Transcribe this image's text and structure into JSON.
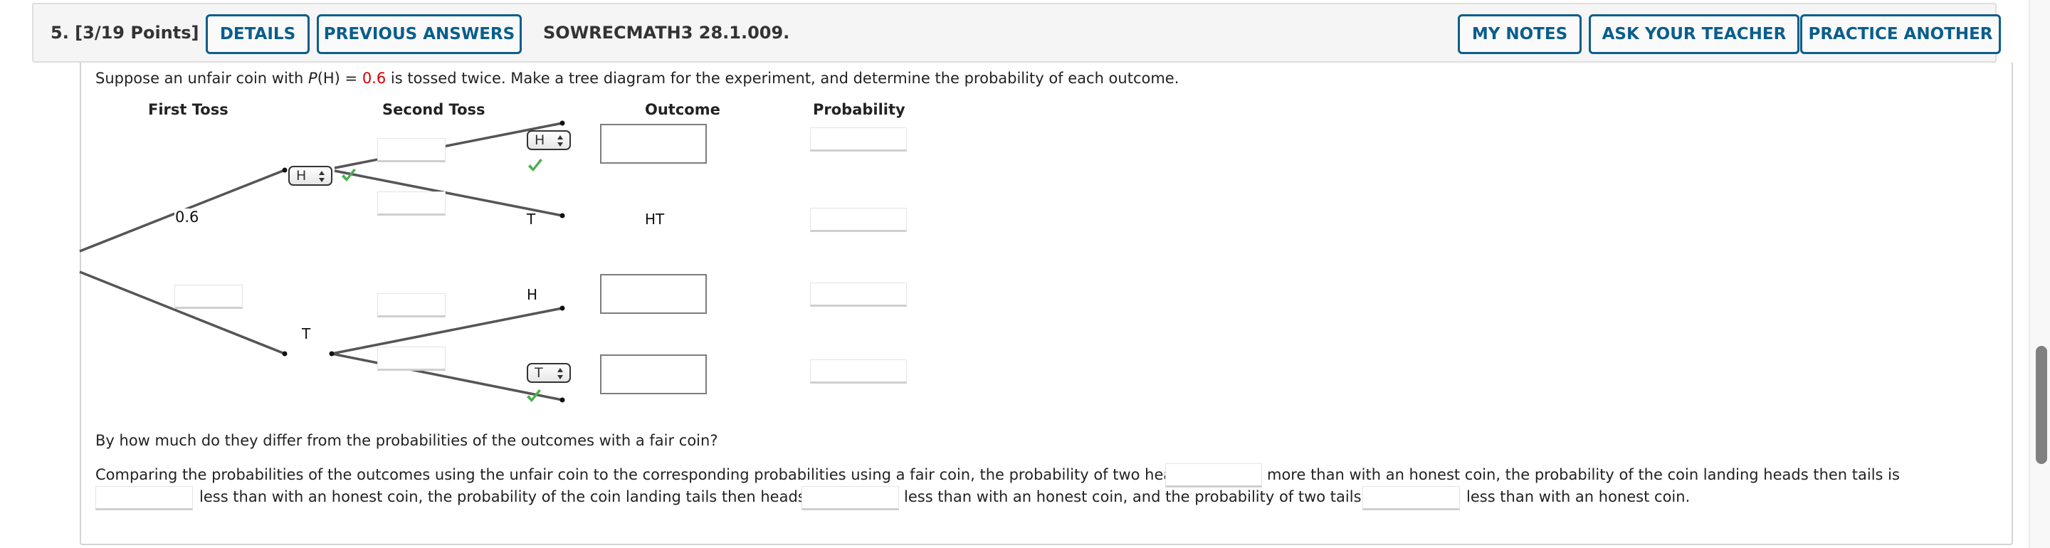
{
  "question": {
    "number_label": "5.  [3/19 Points]",
    "code": "SOWRECMATH3 28.1.009."
  },
  "toolbar": {
    "details_label": "DETAILS",
    "previous_answers_label": "PREVIOUS ANSWERS",
    "my_notes_label": "MY NOTES",
    "ask_teacher_label": "ASK YOUR TEACHER",
    "practice_another_label": "PRACTICE ANOTHER"
  },
  "prompt": {
    "before": "Suppose an unfair coin with ",
    "p_label": "P",
    "p_arg": "(H) = ",
    "p_value": "0.6",
    "after": " is tossed twice. Make a tree diagram for the experiment, and determine the probability of each outcome."
  },
  "columns": {
    "first_toss": "First Toss",
    "second_toss": "Second Toss",
    "outcome": "Outcome",
    "probability": "Probability"
  },
  "tree": {
    "first_branch_prob_given": "0.6",
    "first_h_select": {
      "value": "H",
      "status": "correct"
    },
    "first_t_label": "T",
    "second_hh_select": {
      "value": "H",
      "status": "correct"
    },
    "second_ht_label": "T",
    "second_th_label": "H",
    "second_tt_select": {
      "value": "T",
      "status": "correct"
    },
    "outcomes": {
      "hh": "",
      "ht": "HT",
      "th": "",
      "tt": ""
    },
    "probabilities": {
      "hh": "",
      "ht": "",
      "th": "",
      "tt": ""
    },
    "branch_inputs": {
      "first_t": "",
      "second_hh": "",
      "second_ht": "",
      "second_th": "",
      "second_tt": ""
    }
  },
  "followup": {
    "question": "By how much do they differ from the probabilities of the outcomes with a fair coin?",
    "part1": "Comparing the probabilities of the outcomes using the unfair coin to the corresponding probabilities using a fair coin, the probability of two heads is",
    "part2": "more than with an honest coin, the probability of the coin landing heads then tails is",
    "part3": "less than with an honest coin, the probability of the coin landing tails then heads is",
    "part4": "less than with an honest coin, and the probability of two tails is",
    "part5": "less than with an honest coin.",
    "inputs": {
      "two_heads_diff": "",
      "heads_tails_diff": "",
      "tails_heads_diff": "",
      "two_tails_diff": ""
    }
  },
  "colors": {
    "accent": "#0a5e8c",
    "given_value": "#d40000",
    "correct_check": "#4caf50"
  }
}
